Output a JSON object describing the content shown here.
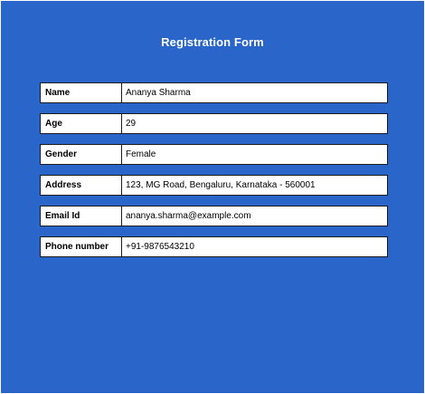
{
  "form": {
    "title": "Registration Form",
    "fields": [
      {
        "label": "Name",
        "value": "Ananya Sharma"
      },
      {
        "label": "Age",
        "value": "29"
      },
      {
        "label": "Gender",
        "value": "Female"
      },
      {
        "label": "Address",
        "value": "123, MG Road, Bengaluru, Karnataka - 560001"
      },
      {
        "label": "Email Id",
        "value": "ananya.sharma@example.com"
      },
      {
        "label": "Phone number",
        "value": "+91-9876543210"
      }
    ]
  },
  "colors": {
    "background": "#2a66c9",
    "border": "#1b1b1b",
    "cell": "#ffffff"
  }
}
